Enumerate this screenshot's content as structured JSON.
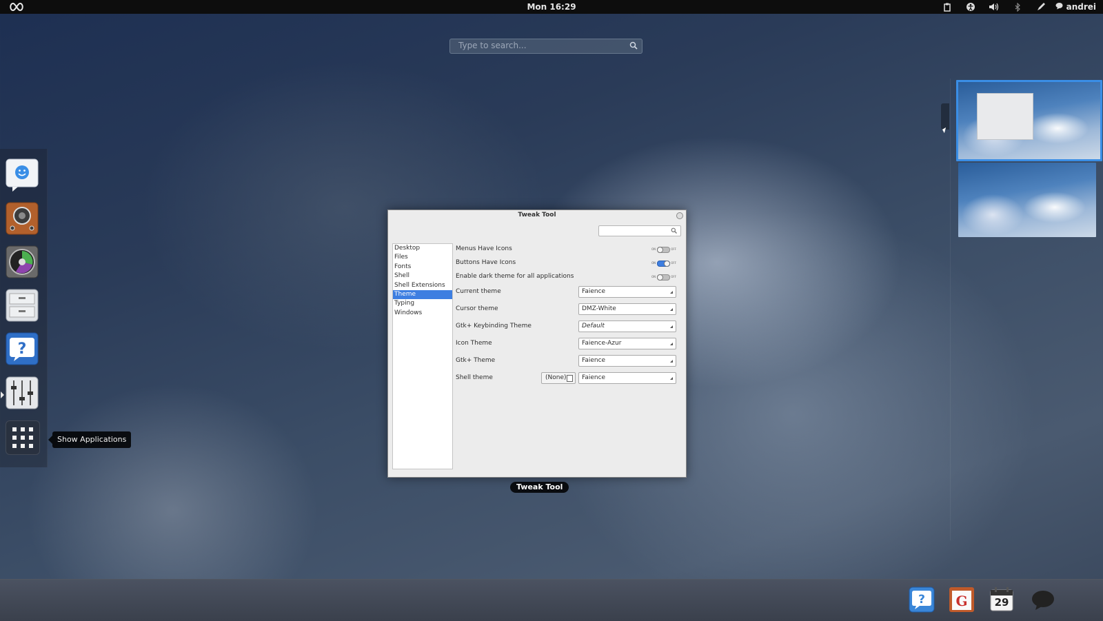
{
  "topbar": {
    "clock": "Mon 16:29",
    "user": "andrei",
    "tray_icons": [
      "clipboard-icon",
      "accessibility-icon",
      "volume-icon",
      "bluetooth-icon",
      "pen-icon"
    ]
  },
  "search": {
    "placeholder": "Type to search..."
  },
  "dash": {
    "items": [
      "empathy-chat",
      "speaker-settings",
      "disk-usage",
      "file-manager",
      "help",
      "sound-mixer",
      "show-applications"
    ],
    "tooltip": "Show Applications"
  },
  "window": {
    "title": "Tweak Tool",
    "caption": "Tweak Tool",
    "sidebar": [
      "Desktop",
      "Files",
      "Fonts",
      "Shell",
      "Shell Extensions",
      "Theme",
      "Typing",
      "Windows"
    ],
    "selected": "Theme",
    "switches": [
      {
        "label": "Menus Have Icons",
        "state": "off"
      },
      {
        "label": "Buttons Have Icons",
        "state": "on"
      },
      {
        "label": "Enable dark theme for all applications",
        "state": "off"
      }
    ],
    "switch_on_text": "ON",
    "switch_off_text": "OFF",
    "combos": [
      {
        "label": "Current theme",
        "value": "Faience"
      },
      {
        "label": "Cursor theme",
        "value": "DMZ-White"
      },
      {
        "label": "Gtk+ Keybinding Theme",
        "value": "Default"
      },
      {
        "label": "Icon Theme",
        "value": "Faience-Azur"
      },
      {
        "label": "Gtk+ Theme",
        "value": "Faience"
      },
      {
        "label": "Shell theme",
        "value": "Faience",
        "file": "(None)"
      }
    ]
  },
  "bottom": {
    "calendar_day": "29",
    "items": [
      "help-icon",
      "gmail-icon",
      "calendar-icon",
      "chat-status-icon"
    ]
  },
  "colors": {
    "accent": "#3d7ee1",
    "topbar": "#0d0d0d"
  }
}
